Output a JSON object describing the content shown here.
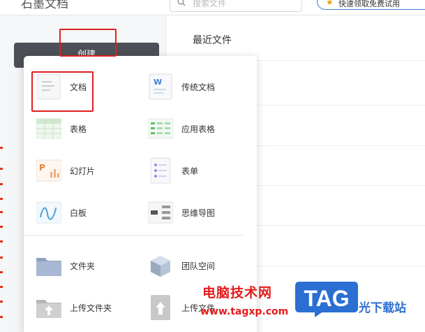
{
  "header": {
    "app_title": "石墨文档",
    "search_placeholder": "搜索文件",
    "promo_text": "快速领取免费试用"
  },
  "sidebar": {
    "create_label": "创建"
  },
  "main": {
    "title": "最近文件"
  },
  "create_menu": {
    "items": [
      {
        "label": "文档",
        "icon": "doc-icon"
      },
      {
        "label": "传统文档",
        "icon": "word-doc-icon"
      },
      {
        "label": "表格",
        "icon": "sheet-icon"
      },
      {
        "label": "应用表格",
        "icon": "app-sheet-icon"
      },
      {
        "label": "幻灯片",
        "icon": "slides-icon"
      },
      {
        "label": "表单",
        "icon": "form-icon"
      },
      {
        "label": "白板",
        "icon": "whiteboard-icon"
      },
      {
        "label": "思维导图",
        "icon": "mindmap-icon"
      },
      {
        "label": "文件夹",
        "icon": "folder-icon"
      },
      {
        "label": "团队空间",
        "icon": "team-space-icon"
      },
      {
        "label": "上传文件夹",
        "icon": "upload-folder-icon"
      },
      {
        "label": "上传文件",
        "icon": "upload-file-icon"
      }
    ]
  },
  "watermark": {
    "cn": "电脑技术网",
    "url": "www.tagxp.com",
    "logo": "TAG",
    "site": "光下载站"
  },
  "colors": {
    "create_button": "#4d5157",
    "highlight": "#e02020",
    "watermark_red": "#e31b1b",
    "tag_blue": "#2a6fd1"
  }
}
